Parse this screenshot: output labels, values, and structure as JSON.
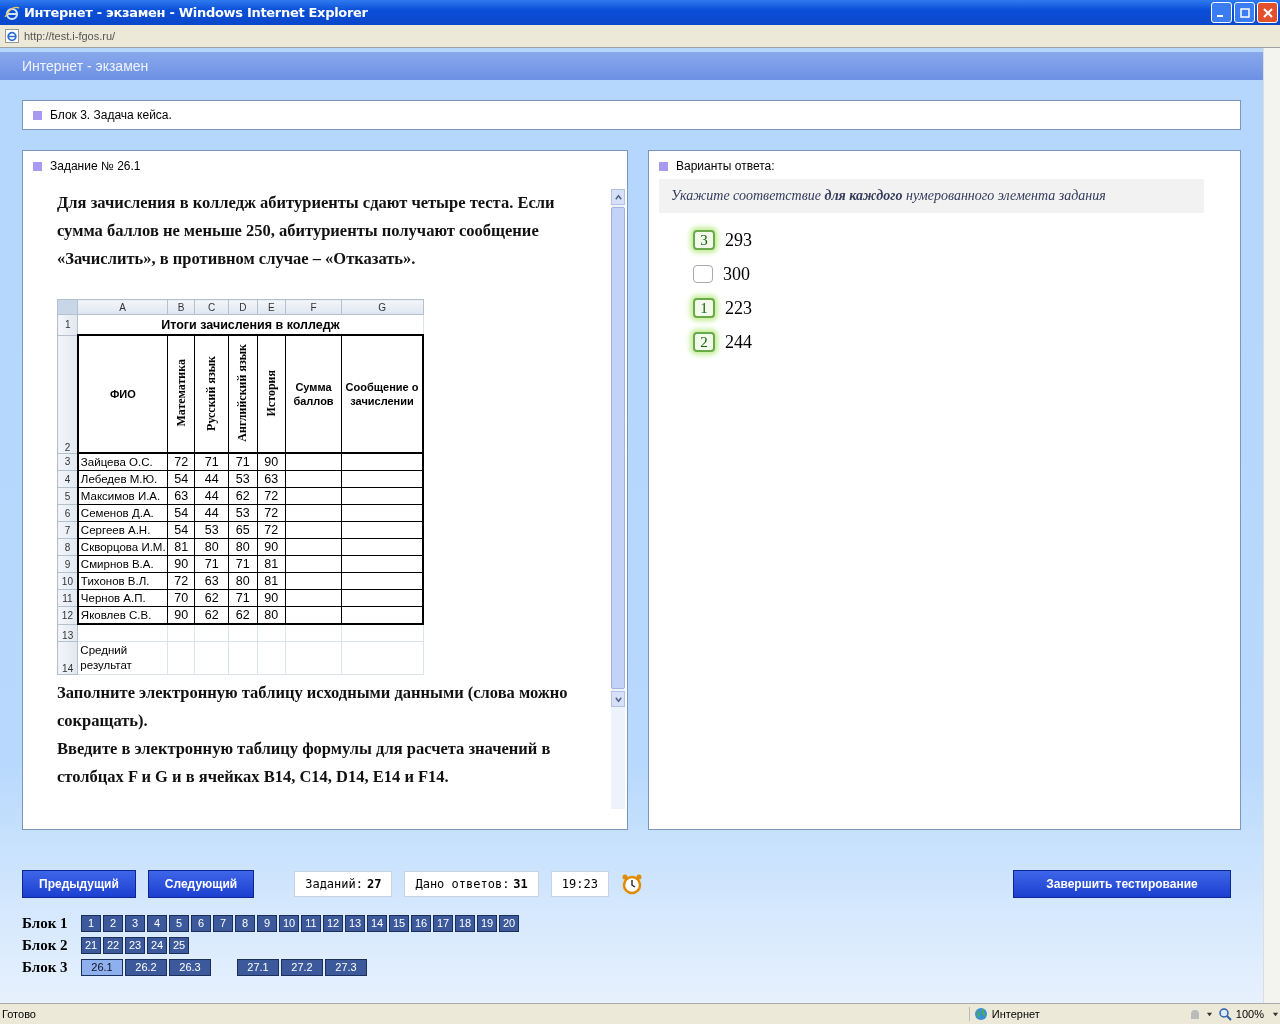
{
  "window": {
    "title": "Интернет - экзамен - Windows Internet Explorer"
  },
  "address": "http://test.i-fgos.ru/",
  "page_header": "Интернет - экзамен",
  "block_title": "Блок 3. Задача кейса.",
  "task": {
    "title": "Задание № 26.1",
    "intro": "Для зачисления в колледж абитуриенты сдают четыре теста. Если сумма баллов не меньше 250, абитуриенты получают сообщение «Зачислить», в противном случае – «Отказать».",
    "spreadsheet": {
      "columns": [
        "A",
        "B",
        "C",
        "D",
        "E",
        "F",
        "G"
      ],
      "title_row": {
        "number": "1",
        "text": "Итоги зачисления в колледж"
      },
      "header_row": {
        "number": "2",
        "cells": [
          {
            "text": "ФИО",
            "rotated": false
          },
          {
            "text": "Математика",
            "rotated": true
          },
          {
            "text": "Русский язык",
            "rotated": true
          },
          {
            "text": "Английский язык",
            "rotated": true
          },
          {
            "text": "История",
            "rotated": true
          },
          {
            "text": "Сумма баллов",
            "rotated": false
          },
          {
            "text": "Сообщение о зачислении",
            "rotated": false
          }
        ]
      },
      "rows": [
        {
          "number": "3",
          "cells": [
            "Зайцева О.С.",
            "72",
            "71",
            "71",
            "90"
          ]
        },
        {
          "number": "4",
          "cells": [
            "Лебедев М.Ю.",
            "54",
            "44",
            "53",
            "63"
          ]
        },
        {
          "number": "5",
          "cells": [
            "Максимов И.А.",
            "63",
            "44",
            "62",
            "72"
          ]
        },
        {
          "number": "6",
          "cells": [
            "Семенов Д.А.",
            "54",
            "44",
            "53",
            "72"
          ]
        },
        {
          "number": "7",
          "cells": [
            "Сергеев А.Н.",
            "54",
            "53",
            "65",
            "72"
          ]
        },
        {
          "number": "8",
          "cells": [
            "Скворцова И.М.",
            "81",
            "80",
            "80",
            "90"
          ]
        },
        {
          "number": "9",
          "cells": [
            "Смирнов В.А.",
            "90",
            "71",
            "71",
            "81"
          ]
        },
        {
          "number": "10",
          "cells": [
            "Тихонов В.Л.",
            "72",
            "63",
            "80",
            "81"
          ]
        },
        {
          "number": "11",
          "cells": [
            "Чернов А.П.",
            "70",
            "62",
            "71",
            "90"
          ]
        },
        {
          "number": "12",
          "cells": [
            "Яковлев С.В.",
            "90",
            "62",
            "62",
            "80"
          ]
        }
      ],
      "extra_rows": [
        {
          "number": "13",
          "label": ""
        },
        {
          "number": "14",
          "label": "Средний результат"
        }
      ]
    },
    "instructions": [
      "Заполните электронную таблицу исходными данными (слова можно сокращать).",
      "Введите в электронную таблицу формулы для расчета значений в столбцах F и G и в ячейках B14, C14, D14, E14 и F14."
    ]
  },
  "answers": {
    "title": "Варианты ответа:",
    "hint": "Укажите соответствие **для каждого** нумерованного элемента задания",
    "options": [
      {
        "number": "3",
        "value": "293",
        "matched": true
      },
      {
        "value": "300",
        "matched": false
      },
      {
        "number": "1",
        "value": "223",
        "matched": true
      },
      {
        "number": "2",
        "value": "244",
        "matched": true
      }
    ]
  },
  "nav": {
    "previous": "Предыдущий",
    "next": "Следующий",
    "tasks_label": "Заданий:",
    "tasks_count": "27",
    "answered_label": "Дано ответов:",
    "answered_count": "31",
    "time": "19:23",
    "finish": "Завершить тестирование"
  },
  "blocks": [
    {
      "label": "Блок 1",
      "groups": [
        [
          {
            "label": "1",
            "selected": false
          },
          {
            "label": "2",
            "selected": false
          },
          {
            "label": "3",
            "selected": false
          },
          {
            "label": "4",
            "selected": false
          },
          {
            "label": "5",
            "selected": false
          },
          {
            "label": "6",
            "selected": false
          },
          {
            "label": "7",
            "selected": false
          },
          {
            "label": "8",
            "selected": false
          },
          {
            "label": "9",
            "selected": false
          },
          {
            "label": "10",
            "selected": false
          },
          {
            "label": "11",
            "selected": false
          },
          {
            "label": "12",
            "selected": false
          },
          {
            "label": "13",
            "selected": false
          },
          {
            "label": "14",
            "selected": false
          },
          {
            "label": "15",
            "selected": false
          },
          {
            "label": "16",
            "selected": false
          },
          {
            "label": "17",
            "selected": false
          },
          {
            "label": "18",
            "selected": false
          },
          {
            "label": "19",
            "selected": false
          },
          {
            "label": "20",
            "selected": false
          }
        ]
      ]
    },
    {
      "label": "Блок 2",
      "groups": [
        [
          {
            "label": "21",
            "selected": false
          },
          {
            "label": "22",
            "selected": false
          },
          {
            "label": "23",
            "selected": false
          },
          {
            "label": "24",
            "selected": false
          },
          {
            "label": "25",
            "selected": false
          }
        ]
      ]
    },
    {
      "label": "Блок 3",
      "groups": [
        [
          {
            "label": "26.1",
            "selected": true
          },
          {
            "label": "26.2",
            "selected": false
          },
          {
            "label": "26.3",
            "selected": false
          }
        ],
        [
          {
            "label": "27.1",
            "selected": false
          },
          {
            "label": "27.2",
            "selected": false
          },
          {
            "label": "27.3",
            "selected": false
          }
        ]
      ]
    }
  ],
  "status_bar": {
    "text": "Готово",
    "zone": "Интернет",
    "zoom": "100%"
  }
}
